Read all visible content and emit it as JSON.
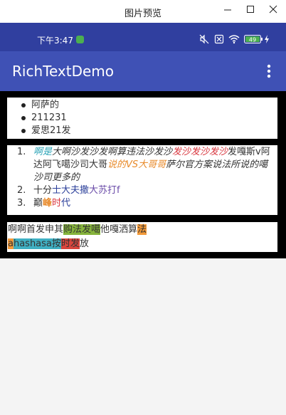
{
  "window": {
    "title": "图片预览"
  },
  "status_bar": {
    "time": "下午3:47",
    "battery": "49"
  },
  "app_bar": {
    "title": "RichTextDemo"
  },
  "bullet_list": [
    "阿萨的",
    "211231",
    "爱思21发"
  ],
  "ordered_list": {
    "item1": {
      "num": "1.",
      "s1": "啊是",
      "s2": "大啊沙发沙发啊算违法沙发沙",
      "s3": "发沙发沙发沙",
      "s4": "发嘎斯v阿达阿飞噶沙司大哥",
      "s5": "说的VS大哥哥",
      "s6": "萨尔官方案说法所说的噶沙司更多的"
    },
    "item2": {
      "num": "2.",
      "s1": "十分",
      "s2": "士大夫撒",
      "s3": "大苏打f"
    },
    "item3": {
      "num": "3.",
      "s1": "巅",
      "s2": "峰",
      "s3": "时",
      "s4": "代"
    }
  },
  "highlight_text": {
    "s1": "啊啊首发申其",
    "s2": "购法发噶",
    "s3": "他嘎洒算",
    "s4": "法",
    "s5": "a",
    "s6": "hashasa按",
    "s7": "时发",
    "s8": "放"
  },
  "colors": {
    "status_bar": "#303F9F",
    "app_bar": "#3F51B5",
    "teal": "#2aa3b6",
    "red": "#d9363e",
    "orange": "#e88a2a",
    "green_bg": "#86b43c"
  }
}
